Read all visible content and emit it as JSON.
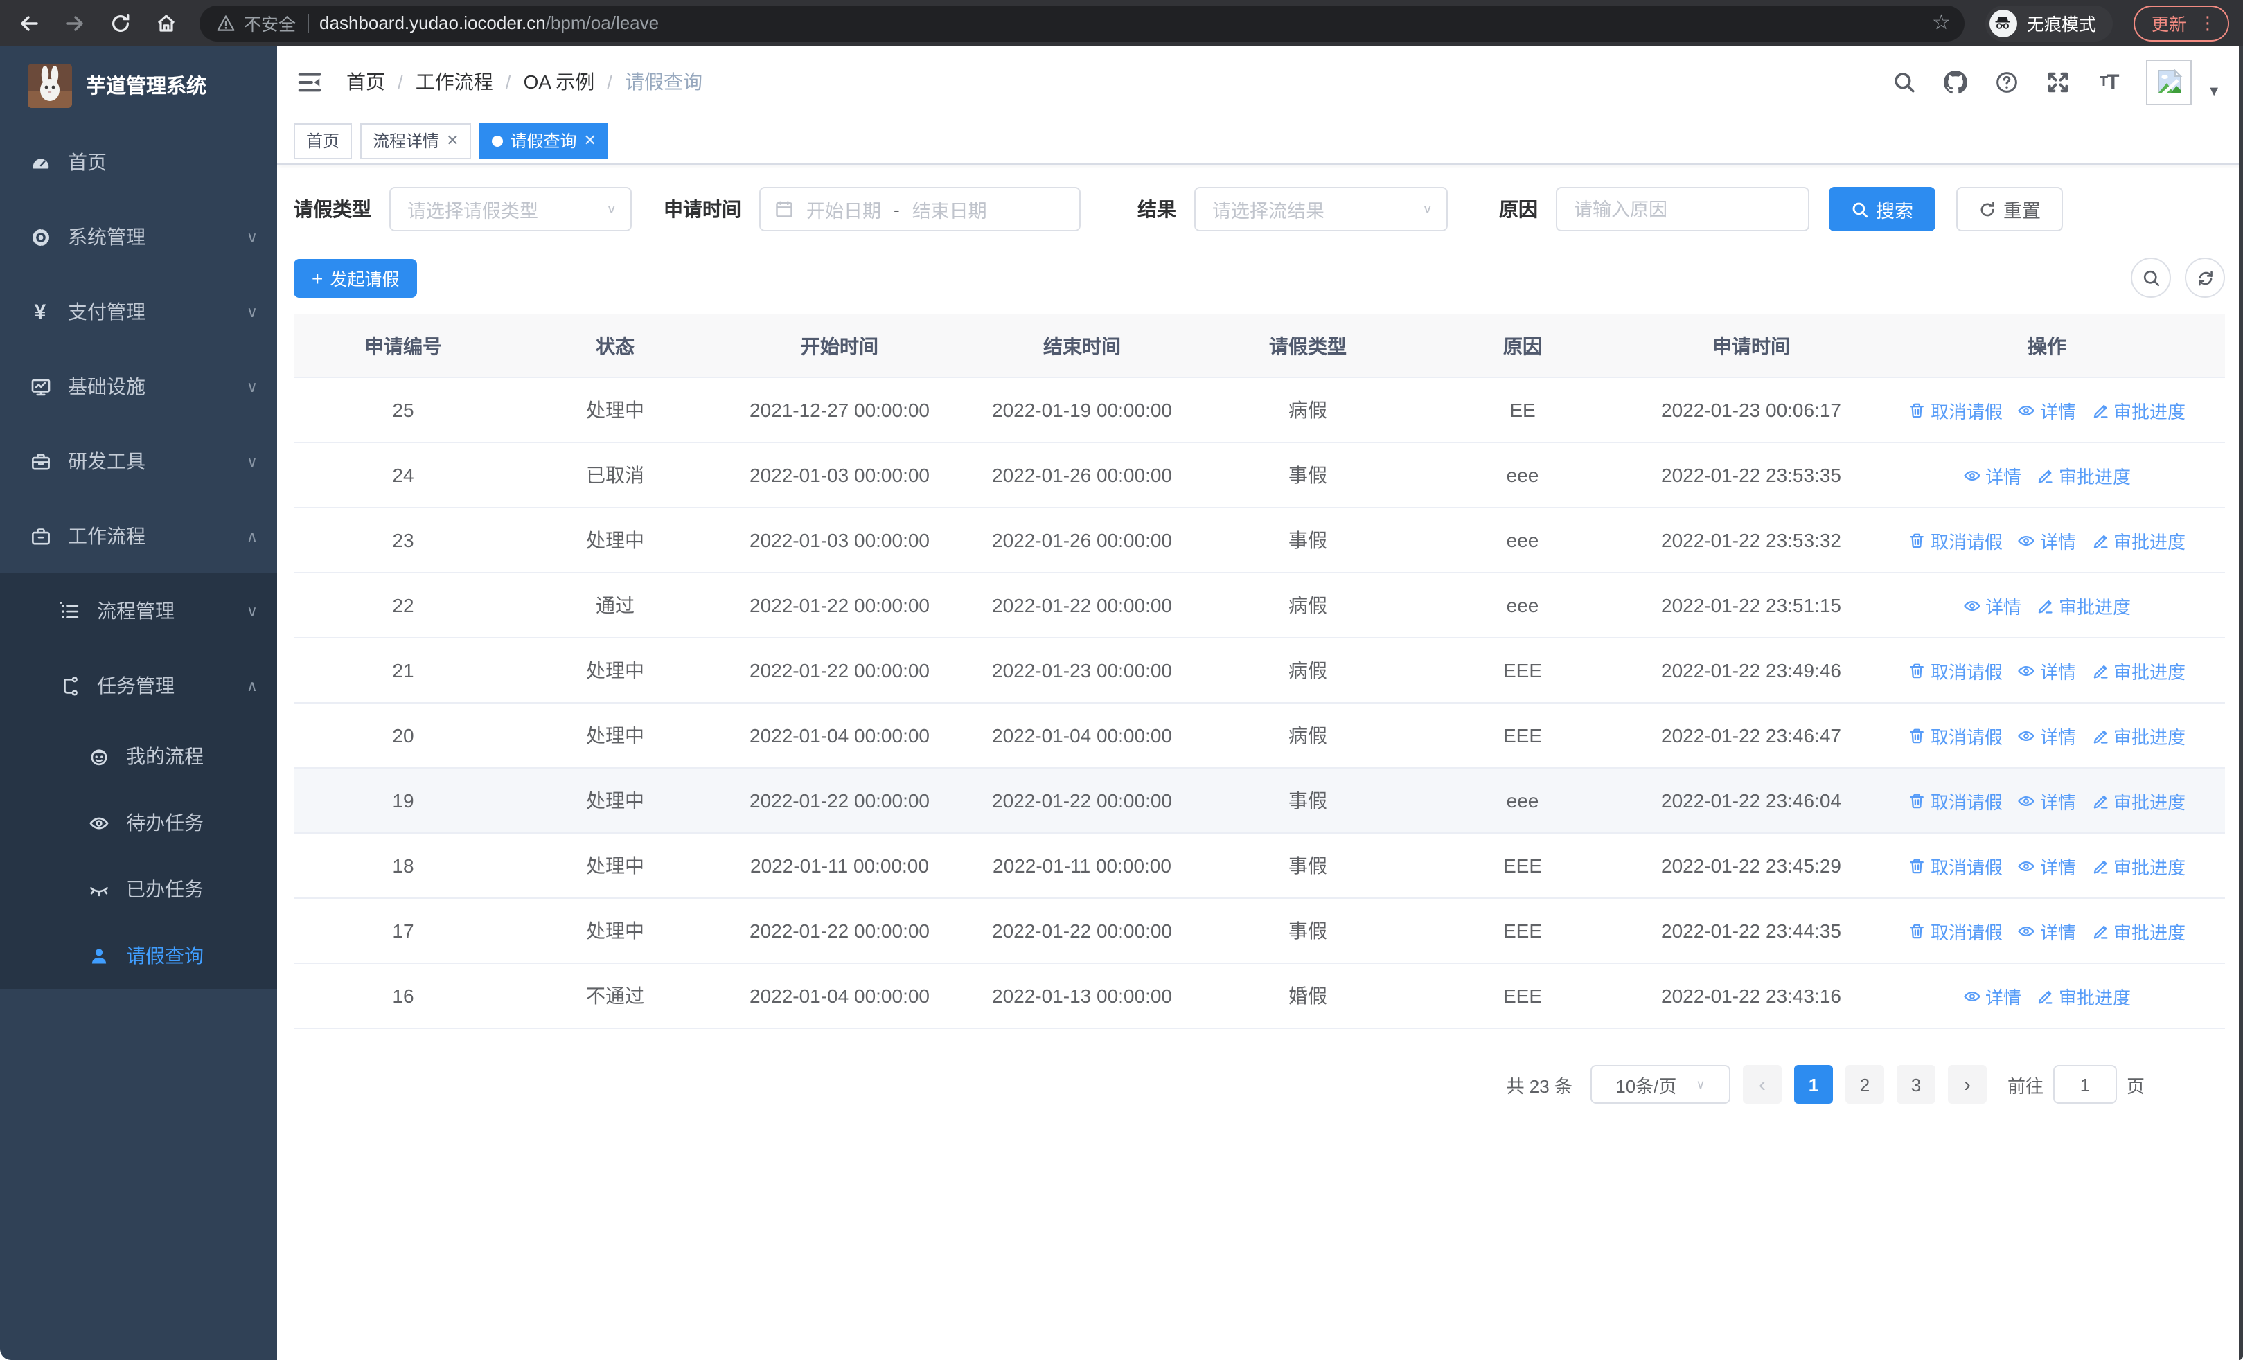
{
  "browser": {
    "security_label": "不安全",
    "url_host": "dashboard.yudao.iocoder.cn",
    "url_path": "/bpm/oa/leave",
    "incognito_label": "无痕模式",
    "update_label": "更新"
  },
  "sidebar": {
    "title": "芋道管理系统",
    "items": [
      {
        "key": "home",
        "label": "首页",
        "icon": "dashboard-icon",
        "level": 1,
        "chevron": "",
        "active": false,
        "in_expanded": false
      },
      {
        "key": "system",
        "label": "系统管理",
        "icon": "gear-icon",
        "level": 1,
        "chevron": "down",
        "active": false,
        "in_expanded": false
      },
      {
        "key": "payment",
        "label": "支付管理",
        "icon": "yen-icon",
        "level": 1,
        "chevron": "down",
        "active": false,
        "in_expanded": false
      },
      {
        "key": "infra",
        "label": "基础设施",
        "icon": "monitor-icon",
        "level": 1,
        "chevron": "down",
        "active": false,
        "in_expanded": false
      },
      {
        "key": "devtools",
        "label": "研发工具",
        "icon": "toolbox-icon",
        "level": 1,
        "chevron": "down",
        "active": false,
        "in_expanded": false
      },
      {
        "key": "workflow",
        "label": "工作流程",
        "icon": "briefcase-icon",
        "level": 1,
        "chevron": "up",
        "active": false,
        "in_expanded": false
      },
      {
        "key": "process-mgmt",
        "label": "流程管理",
        "icon": "list-icon",
        "level": 2,
        "chevron": "down",
        "active": false,
        "in_expanded": true
      },
      {
        "key": "task-mgmt",
        "label": "任务管理",
        "icon": "flow-icon",
        "level": 2,
        "chevron": "up",
        "active": false,
        "in_expanded": true
      },
      {
        "key": "my-process",
        "label": "我的流程",
        "icon": "robot-icon",
        "level": 3,
        "chevron": "",
        "active": false,
        "in_expanded": true
      },
      {
        "key": "todo-task",
        "label": "待办任务",
        "icon": "eye-icon",
        "level": 3,
        "chevron": "",
        "active": false,
        "in_expanded": true
      },
      {
        "key": "done-task",
        "label": "已办任务",
        "icon": "eye-closed-icon",
        "level": 3,
        "chevron": "",
        "active": false,
        "in_expanded": true
      },
      {
        "key": "leave-query",
        "label": "请假查询",
        "icon": "user-icon",
        "level": 3,
        "chevron": "",
        "active": true,
        "in_expanded": true
      }
    ]
  },
  "header": {
    "breadcrumb": [
      "首页",
      "工作流程",
      "OA 示例",
      "请假查询"
    ]
  },
  "tabs": [
    {
      "label": "首页",
      "closable": false,
      "active": false
    },
    {
      "label": "流程详情",
      "closable": true,
      "active": false
    },
    {
      "label": "请假查询",
      "closable": true,
      "active": true
    }
  ],
  "filters": {
    "type_label": "请假类型",
    "type_placeholder": "请选择请假类型",
    "time_label": "申请时间",
    "start_placeholder": "开始日期",
    "range_separator": "-",
    "end_placeholder": "结束日期",
    "result_label": "结果",
    "result_placeholder": "请选择流结果",
    "reason_label": "原因",
    "reason_placeholder": "请输入原因",
    "search_label": "搜索",
    "reset_label": "重置"
  },
  "toolbar": {
    "create_label": "发起请假"
  },
  "table": {
    "columns": [
      "申请编号",
      "状态",
      "开始时间",
      "结束时间",
      "请假类型",
      "原因",
      "申请时间",
      "操作"
    ],
    "action_labels": {
      "cancel": "取消请假",
      "detail": "详情",
      "progress": "审批进度"
    },
    "rows": [
      {
        "id": "25",
        "status": "处理中",
        "start": "2021-12-27 00:00:00",
        "end": "2022-01-19 00:00:00",
        "type": "病假",
        "reason": "EE",
        "applied": "2022-01-23 00:06:17",
        "actions": [
          "cancel",
          "detail",
          "progress"
        ],
        "highlight": false
      },
      {
        "id": "24",
        "status": "已取消",
        "start": "2022-01-03 00:00:00",
        "end": "2022-01-26 00:00:00",
        "type": "事假",
        "reason": "eee",
        "applied": "2022-01-22 23:53:35",
        "actions": [
          "detail",
          "progress"
        ],
        "highlight": false
      },
      {
        "id": "23",
        "status": "处理中",
        "start": "2022-01-03 00:00:00",
        "end": "2022-01-26 00:00:00",
        "type": "事假",
        "reason": "eee",
        "applied": "2022-01-22 23:53:32",
        "actions": [
          "cancel",
          "detail",
          "progress"
        ],
        "highlight": false
      },
      {
        "id": "22",
        "status": "通过",
        "start": "2022-01-22 00:00:00",
        "end": "2022-01-22 00:00:00",
        "type": "病假",
        "reason": "eee",
        "applied": "2022-01-22 23:51:15",
        "actions": [
          "detail",
          "progress"
        ],
        "highlight": false
      },
      {
        "id": "21",
        "status": "处理中",
        "start": "2022-01-22 00:00:00",
        "end": "2022-01-23 00:00:00",
        "type": "病假",
        "reason": "EEE",
        "applied": "2022-01-22 23:49:46",
        "actions": [
          "cancel",
          "detail",
          "progress"
        ],
        "highlight": false
      },
      {
        "id": "20",
        "status": "处理中",
        "start": "2022-01-04 00:00:00",
        "end": "2022-01-04 00:00:00",
        "type": "病假",
        "reason": "EEE",
        "applied": "2022-01-22 23:46:47",
        "actions": [
          "cancel",
          "detail",
          "progress"
        ],
        "highlight": false
      },
      {
        "id": "19",
        "status": "处理中",
        "start": "2022-01-22 00:00:00",
        "end": "2022-01-22 00:00:00",
        "type": "事假",
        "reason": "eee",
        "applied": "2022-01-22 23:46:04",
        "actions": [
          "cancel",
          "detail",
          "progress"
        ],
        "highlight": true
      },
      {
        "id": "18",
        "status": "处理中",
        "start": "2022-01-11 00:00:00",
        "end": "2022-01-11 00:00:00",
        "type": "事假",
        "reason": "EEE",
        "applied": "2022-01-22 23:45:29",
        "actions": [
          "cancel",
          "detail",
          "progress"
        ],
        "highlight": false
      },
      {
        "id": "17",
        "status": "处理中",
        "start": "2022-01-22 00:00:00",
        "end": "2022-01-22 00:00:00",
        "type": "事假",
        "reason": "EEE",
        "applied": "2022-01-22 23:44:35",
        "actions": [
          "cancel",
          "detail",
          "progress"
        ],
        "highlight": false
      },
      {
        "id": "16",
        "status": "不通过",
        "start": "2022-01-04 00:00:00",
        "end": "2022-01-13 00:00:00",
        "type": "婚假",
        "reason": "EEE",
        "applied": "2022-01-22 23:43:16",
        "actions": [
          "detail",
          "progress"
        ],
        "highlight": false
      }
    ]
  },
  "pagination": {
    "total_label": "共 23 条",
    "page_size": "10条/页",
    "pages": [
      "1",
      "2",
      "3"
    ],
    "current": "1",
    "prev_symbol": "‹",
    "next_symbol": "›",
    "goto_label": "前往",
    "goto_value": "1",
    "unit_label": "页"
  },
  "colors": {
    "accent": "#2d8cf0",
    "link": "#579cf8",
    "sidebar_bg": "#304156",
    "submenu_bg": "#263445",
    "active_blue": "#409eff"
  }
}
